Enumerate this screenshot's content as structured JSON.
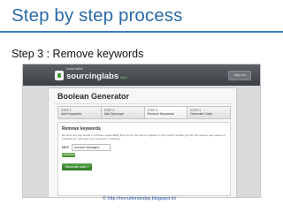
{
  "slide": {
    "title": "Step by step process",
    "subtitle": "Step 3 : Remove keywords",
    "credit": "© http://recruiterstoday.blogspot.in/"
  },
  "app": {
    "logo_small": "social talent",
    "logo_main": "sourcinglabs",
    "logo_beta": "beta",
    "signout_label": "Sign out",
    "panel_title": "Boolean Generator",
    "steps": [
      {
        "num": "STEP 1",
        "label": "Add Keywords"
      },
      {
        "num": "STEP 2",
        "label": "Add Synonym"
      },
      {
        "num": "STEP 3",
        "label": "Remove Keywords"
      },
      {
        "num": "STEP 4",
        "label": "Generate Code"
      }
    ],
    "active_step": 2,
    "card": {
      "heading": "Remove keywords",
      "text": "Remove any key words or phrases sequentially that you do not want to appear in your search results (you do not need to use quotes or brackets etc. just enter your keyword or phrase).",
      "keyword_label": "NOT",
      "keyword_value": "Account Managers",
      "add_label": "+ Add more",
      "generate_label": "Generate code »"
    }
  },
  "colors": {
    "title": "#2a6aa8",
    "rule": "#3d7cc0",
    "topbar": "#4a4e53",
    "accent_green": "#3f8a2e",
    "credit": "#1f4e99"
  }
}
